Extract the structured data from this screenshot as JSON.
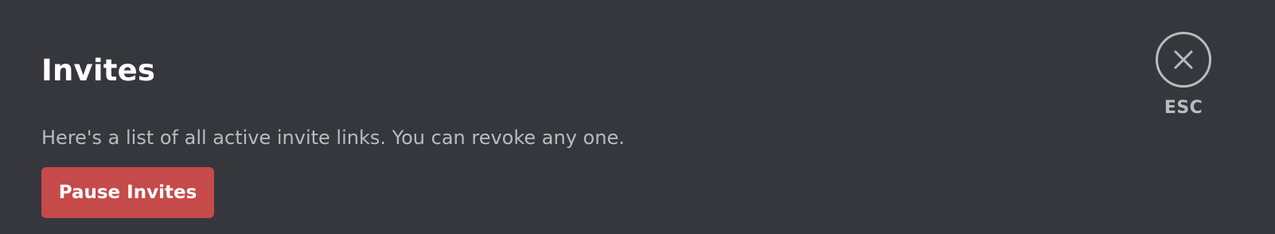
{
  "header": {
    "title": "Invites"
  },
  "content": {
    "description": "Here's a list of all active invite links. You can revoke any one."
  },
  "actions": {
    "pause_invites_label": "Pause Invites"
  },
  "close": {
    "icon": "close-icon",
    "label": "ESC"
  },
  "colors": {
    "background": "#36373d",
    "title": "#ffffff",
    "muted_text": "#b9bbbe",
    "danger": "#c64a4a"
  }
}
